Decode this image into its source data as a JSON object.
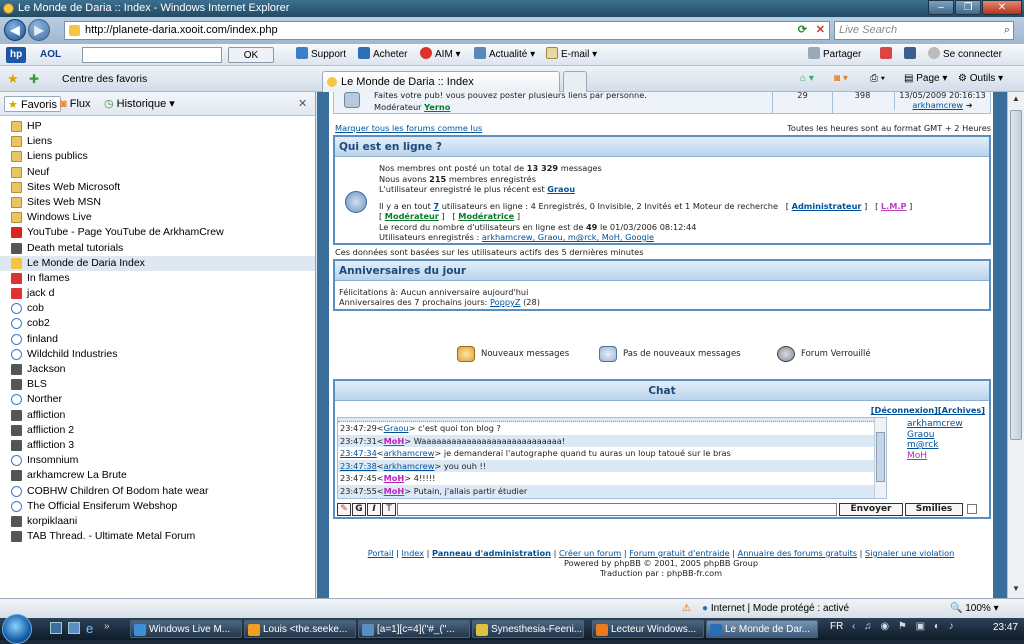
{
  "window": {
    "title": "Le Monde de Daria :: Index - Windows Internet Explorer"
  },
  "address": {
    "url": "http://planete-daria.xooit.com/index.php",
    "search_placeholder": "Live Search"
  },
  "aol_toolbar": {
    "aol": "AOL",
    "ok": "OK",
    "support": "Support",
    "acheter": "Acheter",
    "aim": "AIM",
    "actualite": "Actualité",
    "email": "E-mail",
    "partager": "Partager",
    "connect": "Se connecter"
  },
  "favbar": {
    "centre": "Centre des favoris",
    "tab_title": "Le Monde de Daria :: Index",
    "page": "Page",
    "outils": "Outils"
  },
  "favorites_panel": {
    "tab_favoris": "Favoris",
    "tab_flux": "Flux",
    "tab_historique": "Historique",
    "items": [
      {
        "label": "HP",
        "icon": "folder-icon"
      },
      {
        "label": "Liens",
        "icon": "folder-icon"
      },
      {
        "label": "Liens publics",
        "icon": "folder-icon"
      },
      {
        "label": "Neuf",
        "icon": "folder-icon"
      },
      {
        "label": "Sites Web Microsoft",
        "icon": "folder-icon"
      },
      {
        "label": "Sites Web MSN",
        "icon": "folder-icon"
      },
      {
        "label": "Windows Live",
        "icon": "folder-icon"
      },
      {
        "label": "YouTube - Page YouTube de ArkhamCrew",
        "icon": "youtube-icon"
      },
      {
        "label": "Death metal tutorials",
        "icon": "site-icon"
      },
      {
        "label": "Le Monde de Daria  Index",
        "icon": "daria-icon"
      },
      {
        "label": "In flames",
        "icon": "ap-icon"
      },
      {
        "label": "jack d",
        "icon": "ap-icon"
      },
      {
        "label": "cob",
        "icon": "ie-icon"
      },
      {
        "label": "cob2",
        "icon": "ie-icon"
      },
      {
        "label": "finland",
        "icon": "ie-icon"
      },
      {
        "label": "Wildchild Industries",
        "icon": "ie-icon"
      },
      {
        "label": "Jackson",
        "icon": "site-icon"
      },
      {
        "label": "BLS",
        "icon": "site-icon"
      },
      {
        "label": "Norther",
        "icon": "ie-icon"
      },
      {
        "label": "affliction",
        "icon": "site-icon"
      },
      {
        "label": "affliction 2",
        "icon": "site-icon"
      },
      {
        "label": "affliction 3",
        "icon": "site-icon"
      },
      {
        "label": "Insomnium",
        "icon": "ie-icon"
      },
      {
        "label": "arkhamcrew La Brute",
        "icon": "site-icon"
      },
      {
        "label": "COBHW Children Of Bodom hate wear",
        "icon": "ie-icon"
      },
      {
        "label": "The Official Ensiferum Webshop",
        "icon": "ie-icon"
      },
      {
        "label": "korpiklaani",
        "icon": "site-icon"
      },
      {
        "label": "TAB Thread. - Ultimate Metal Forum",
        "icon": "site-icon"
      }
    ]
  },
  "forum": {
    "top_row": {
      "desc": "Faites votre pub! vous pouvez poster plusieurs liens par personne.",
      "mod_label": "Modérateur",
      "mod_name": "Yerno",
      "topics": "29",
      "posts": "398",
      "date": "13/05/2009 20:16:13",
      "last_user": "arkhamcrew"
    },
    "mark_read": "Marquer tous les forums comme lus",
    "timezone": "Toutes les heures sont au format GMT + 2 Heures",
    "online": {
      "title": "Qui est en ligne ?",
      "line1_pre": "Nos membres ont posté un total de ",
      "line1_num": "13 329",
      "line1_post": " messages",
      "line2_pre": "Nous avons ",
      "line2_num": "215",
      "line2_post": " membres enregistrés",
      "line3_pre": "L'utilisateur enregistré le plus récent est ",
      "line3_user": "Graou",
      "line4_pre": "Il y a en tout ",
      "line4_num": "7",
      "line4_post": " utilisateurs en ligne : 4 Enregistrés, 0 Invisible, 2 Invités et 1 Moteur de recherche",
      "role1": "Administrateur",
      "role2": "L.M.P",
      "role3": "Modérateur",
      "role4": "Modératrice",
      "line6_pre": "Le record du nombre d'utilisateurs en ligne est de ",
      "line6_num": "49",
      "line6_post": " le 01/03/2006 08:12:44",
      "line7_pre": "Utilisateurs enregistrés : ",
      "users": "arkhamcrew, Graou, m@rck, MoH, Google",
      "note": "Ces données sont basées sur les utilisateurs actifs des 5 dernières minutes"
    },
    "birthdays": {
      "title": "Anniversaires du jour",
      "line1": "Félicitations à: Aucun anniversaire aujourd'hui",
      "line2_pre": "Anniversaires des 7 prochains jours: ",
      "line2_user": "PoppyZ",
      "line2_post": " (28)"
    },
    "legend": {
      "new": "Nouveaux messages",
      "no_new": "Pas de nouveaux messages",
      "locked": "Forum Verrouillé"
    },
    "chat": {
      "title": "Chat",
      "disconnect": "[Déconnexion]",
      "archives": "[Archives]",
      "lines": [
        {
          "time": "23:47:29",
          "user": "Graou",
          "msg": " c'est quoi ton blog ?"
        },
        {
          "time": "23:47:31",
          "user": "MoH",
          "msg": " Waaaaaaaaaaaaaaaaaaaaaaaaaaaa!"
        },
        {
          "time": "23:47:34",
          "user": "arkhamcrew",
          "msg": " je demanderai l'autographe quand tu auras un loup tatoué sur le bras"
        },
        {
          "time": "23:47:38",
          "user": "arkhamcrew",
          "msg": " you ouh !!"
        },
        {
          "time": "23:47:45",
          "user": "MoH",
          "msg": " 4!!!!!"
        },
        {
          "time": "23:47:55",
          "user": "MoH",
          "msg": " Putain, j'allais partir étudier"
        }
      ],
      "online_users": [
        "arkhamcrew",
        "Graou",
        "m@rck",
        "MoH"
      ],
      "btn_g": "G",
      "btn_i": "I",
      "btn_t": "T",
      "send": "Envoyer",
      "smilies": "Smilies"
    },
    "footer": {
      "links": [
        "Portail",
        "Index",
        "Panneau d'administration",
        "Créer un forum",
        "Forum gratuit d'entraide",
        "Annuaire des forums gratuits",
        "Signaler une violation"
      ],
      "powered": "Powered by phpBB © 2001, 2005 phpBB Group",
      "translation": "Traduction par : phpBB-fr.com"
    }
  },
  "statusbar": {
    "zone": "Internet | Mode protégé : activé",
    "zoom": "100%"
  },
  "taskbar": {
    "tasks": [
      "Windows Live M...",
      "Louis <the.seeke...",
      "[a=1][c=4](\"#_(\"...",
      "Synesthesia-Feeni...",
      "Lecteur Windows...",
      "Le Monde de Dar..."
    ],
    "lang": "FR",
    "clock": "23:47"
  }
}
